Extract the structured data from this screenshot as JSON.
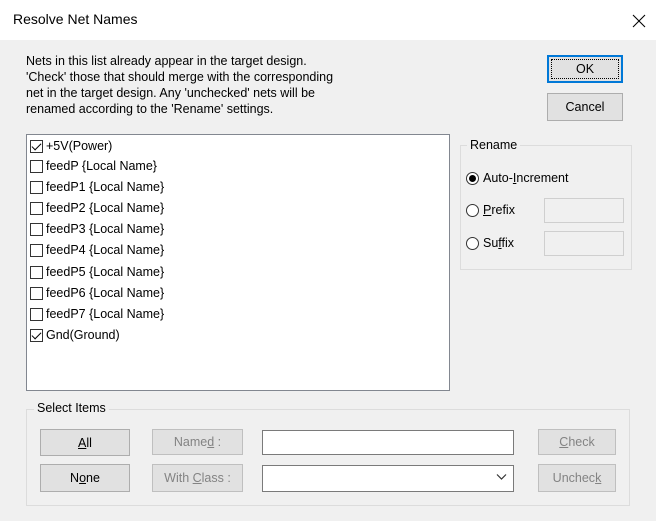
{
  "window": {
    "title": "Resolve Net Names",
    "close_glyph": "✕"
  },
  "intro_text": "Nets in this list already appear in the target design.\n'Check' those that should merge with the corresponding\nnet in the target design. Any 'unchecked' nets will be\nrenamed according to the 'Rename' settings.",
  "buttons": {
    "ok": "OK",
    "cancel": "Cancel"
  },
  "net_list": [
    {
      "label": "+5V(Power)",
      "checked": true
    },
    {
      "label": "feedP {Local Name}",
      "checked": false
    },
    {
      "label": "feedP1 {Local Name}",
      "checked": false
    },
    {
      "label": "feedP2 {Local Name}",
      "checked": false
    },
    {
      "label": "feedP3 {Local Name}",
      "checked": false
    },
    {
      "label": "feedP4 {Local Name}",
      "checked": false
    },
    {
      "label": "feedP5 {Local Name}",
      "checked": false
    },
    {
      "label": "feedP6 {Local Name}",
      "checked": false
    },
    {
      "label": "feedP7 {Local Name}",
      "checked": false
    },
    {
      "label": "Gnd(Ground)",
      "checked": true
    }
  ],
  "rename": {
    "group_label": "Rename",
    "options": {
      "auto_pre": "Auto-",
      "auto_ul": "I",
      "auto_post": "ncrement",
      "prefix_ul": "P",
      "prefix_post": "refix",
      "suffix_pre": "Su",
      "suffix_ul": "f",
      "suffix_post": "fix"
    },
    "selected": "Auto-Increment",
    "prefix_value": "",
    "suffix_value": ""
  },
  "select_items": {
    "group_label": "Select Items",
    "all_ul": "A",
    "all_post": "ll",
    "none_pre": "N",
    "none_ul": "o",
    "none_post": "ne",
    "named_pre": "Name",
    "named_ul": "d",
    "named_post": " :",
    "with_class_pre": "With ",
    "with_class_ul": "C",
    "with_class_post": "lass :",
    "named_value": "",
    "class_value": "",
    "check_ul": "C",
    "check_post": "heck",
    "uncheck_pre": "Unchec",
    "uncheck_ul": "k"
  },
  "icons": {
    "close": "close-icon",
    "dropdown": "chevron-down-icon"
  }
}
